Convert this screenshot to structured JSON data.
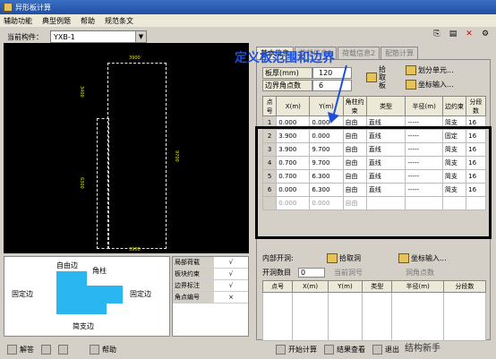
{
  "title": "异形板计算",
  "menu": [
    "辅助功能",
    "典型例题",
    "帮助",
    "规范条文"
  ],
  "member": {
    "label": "当前构件：",
    "value": "YXB-1"
  },
  "annotation": "定义板范围和边界",
  "tabs": [
    "基本信息",
    "荷载信息1",
    "荷载信息2",
    "配筋计算"
  ],
  "fields": {
    "thick_k": "板厚(mm)",
    "thick_v": "120",
    "corners_k": "边界角点数",
    "corners_v": "6"
  },
  "btns": {
    "pick": "拾取板",
    "split": "划分单元...",
    "coord": "坐标输入..."
  },
  "table_headers": [
    "点号",
    "X(m)",
    "Y(m)",
    "角柱约束",
    "类型",
    "半径(m)",
    "边约束",
    "分段数"
  ],
  "rows": [
    [
      "1",
      "0.000",
      "0.000",
      "自由",
      "直线",
      "-----",
      "简支",
      "16"
    ],
    [
      "2",
      "3.900",
      "0.000",
      "自由",
      "直线",
      "-----",
      "固定",
      "16"
    ],
    [
      "3",
      "3.900",
      "9.700",
      "自由",
      "直线",
      "-----",
      "简支",
      "16"
    ],
    [
      "4",
      "0.700",
      "9.700",
      "自由",
      "直线",
      "-----",
      "简支",
      "16"
    ],
    [
      "5",
      "0.700",
      "6.300",
      "自由",
      "直线",
      "-----",
      "简支",
      "16"
    ],
    [
      "6",
      "0.000",
      "6.300",
      "自由",
      "直线",
      "-----",
      "简支",
      "16"
    ],
    [
      "",
      "0.000",
      "0.000",
      "自由",
      "",
      "",
      "",
      ""
    ]
  ],
  "hole": {
    "label": "内部开洞:",
    "pick": "拾取洞",
    "coord": "坐标输入...",
    "count_k": "开洞数目",
    "count_v": "0",
    "cur": "当前洞号",
    "pts": "洞角点数"
  },
  "hole_headers": [
    "点号",
    "X(m)",
    "Y(m)",
    "类型",
    "半径(m)",
    "分段数"
  ],
  "shape_labels": {
    "top": "自由边",
    "corner": "角柱",
    "left": "固定边",
    "right": "固定边",
    "bottom": "简支边"
  },
  "legend": [
    [
      "局部荷载",
      "√"
    ],
    [
      "板块约束",
      "√"
    ],
    [
      "边界标注",
      "√"
    ],
    [
      "角点编号",
      "×"
    ]
  ],
  "bottom": {
    "help1": "解答",
    "help2": "帮助",
    "calc": "开始计算",
    "result": "结果查看",
    "exit": "退出"
  },
  "dims": {
    "top": "3900",
    "left1": "3400",
    "left2": "6300",
    "right": "9700",
    "bottom": "3900"
  },
  "watermark": "结构新手"
}
